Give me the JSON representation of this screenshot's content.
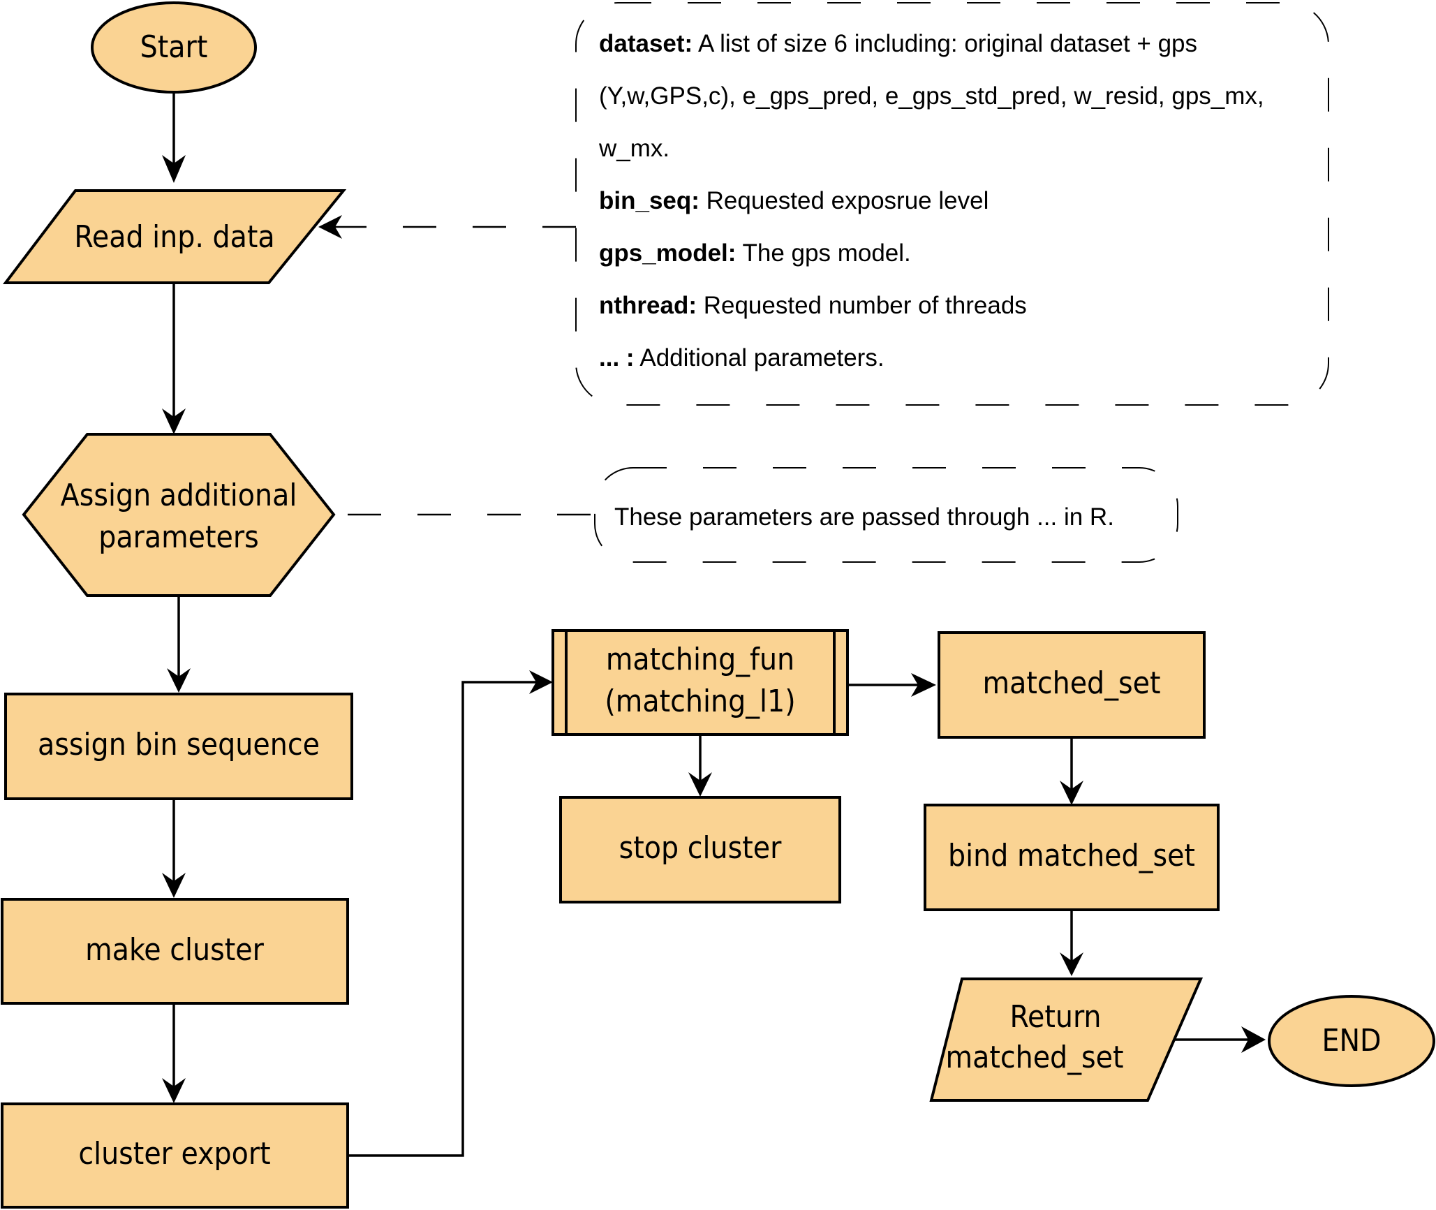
{
  "theme": {
    "node_fill": "#FAD393",
    "stroke": "#000000",
    "background": "#FFFFFF"
  },
  "nodes": {
    "start": "Start",
    "read_input": "Read inp. data",
    "assign_params_line1": "Assign additional",
    "assign_params_line2": "parameters",
    "assign_bin_sequence": "assign bin sequence",
    "make_cluster": "make cluster",
    "cluster_export": "cluster export",
    "matching_fun_line1": "matching_fun",
    "matching_fun_line2": "(matching_l1)",
    "stop_cluster": "stop cluster",
    "matched_set": "matched_set",
    "bind_matched_set": "bind matched_set",
    "return_line1": "Return",
    "return_line2": "matched_set",
    "end": "END"
  },
  "input_note": {
    "lines": [
      {
        "key": "dataset:",
        "text": " A list of size 6 including: original dataset + gps"
      },
      {
        "key": "",
        "text": "(Y,w,GPS,c), e_gps_pred, e_gps_std_pred, w_resid, gps_mx,"
      },
      {
        "key": "",
        "text": "w_mx."
      },
      {
        "key": "bin_seq:",
        "text": " Requested exposrue level"
      },
      {
        "key": "gps_model:",
        "text": " The gps model."
      },
      {
        "key": "nthread:",
        "text": " Requested number of threads"
      },
      {
        "key": "... :",
        "text": " Additional parameters."
      }
    ]
  },
  "params_note": {
    "text": "These parameters are passed through ... in R."
  }
}
